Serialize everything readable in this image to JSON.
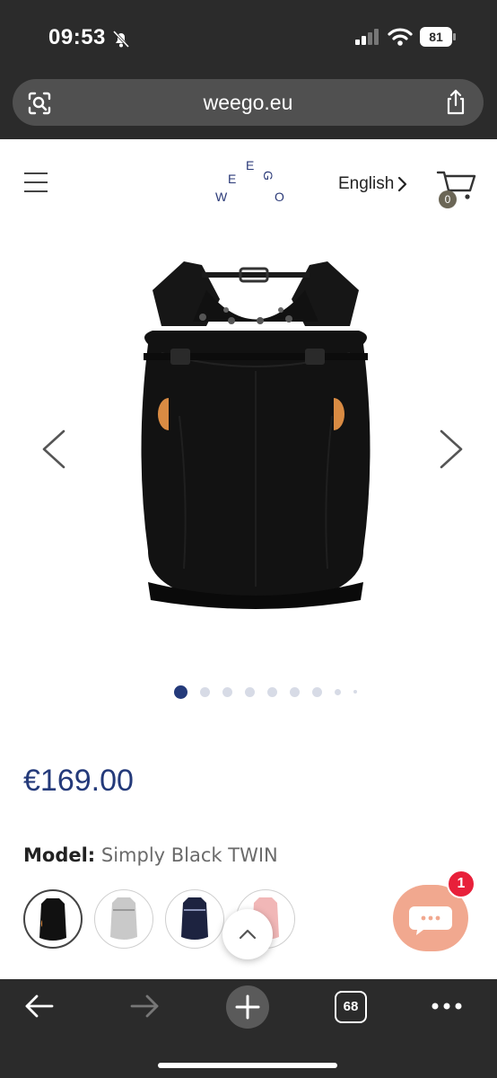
{
  "status_bar": {
    "time": "09:53",
    "battery": "81",
    "icons": [
      "bell-slash-icon",
      "signal-icon",
      "wifi-icon",
      "battery-icon"
    ]
  },
  "browser": {
    "url": "weego.eu",
    "tab_count": "68",
    "icons": [
      "lens-icon",
      "share-icon",
      "back-icon",
      "forward-icon",
      "plus-icon",
      "tabs-icon",
      "more-icon"
    ]
  },
  "header": {
    "logo_letters": [
      "W",
      "E",
      "E",
      "G",
      "O"
    ],
    "language": "English",
    "cart_count": "0"
  },
  "gallery": {
    "image_count": 9,
    "active_index": 0
  },
  "product": {
    "price": "€169.00",
    "model_label": "Model:",
    "model_value": "Simply Black TWIN",
    "variant_colors": [
      "#111111",
      "#c9c9c9",
      "#1d2340",
      "#f1b7b7"
    ]
  },
  "chat": {
    "badge": "1"
  },
  "colors": {
    "accent": "#243a7a",
    "chat": "#f1a88f",
    "badge": "#e8203a",
    "browser_bg": "#2b2b2b"
  }
}
